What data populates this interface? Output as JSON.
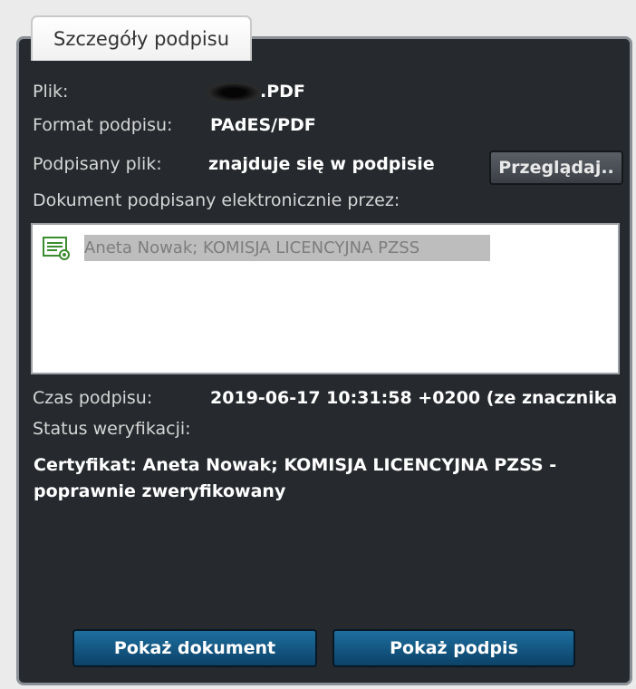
{
  "tab": {
    "title": "Szczegóły podpisu"
  },
  "fields": {
    "file_label": "Plik:",
    "file_value": ".PDF",
    "format_label": "Format podpisu:",
    "format_value": "PAdES/PDF",
    "signed_file_label": "Podpisany plik:",
    "signed_file_value": "znajduje się w podpisie",
    "browse_button": "Przeglądaj..",
    "signed_by_label": "Dokument podpisany elektronicznie przez:",
    "time_label": "Czas podpisu:",
    "time_value": "2019-06-17 10:31:58 +0200 (ze znacznika",
    "status_label": "Status weryfikacji:"
  },
  "signers": [
    {
      "name": "Aneta Nowak; KOMISJA LICENCYJNA PZSS",
      "icon": "certificate-icon",
      "selected": true
    }
  ],
  "verification": {
    "line1": "Certyfikat: Aneta Nowak; KOMISJA LICENCYJNA PZSS -",
    "line2": "poprawnie zweryfikowany"
  },
  "buttons": {
    "show_document": "Pokaż dokument",
    "show_signature": "Pokaż podpis"
  },
  "colors": {
    "panel_bg": "#262a2e",
    "button_blue": "#1d6e9e",
    "selection_gray": "#bdbdbd",
    "icon_green": "#3c8d2f"
  }
}
